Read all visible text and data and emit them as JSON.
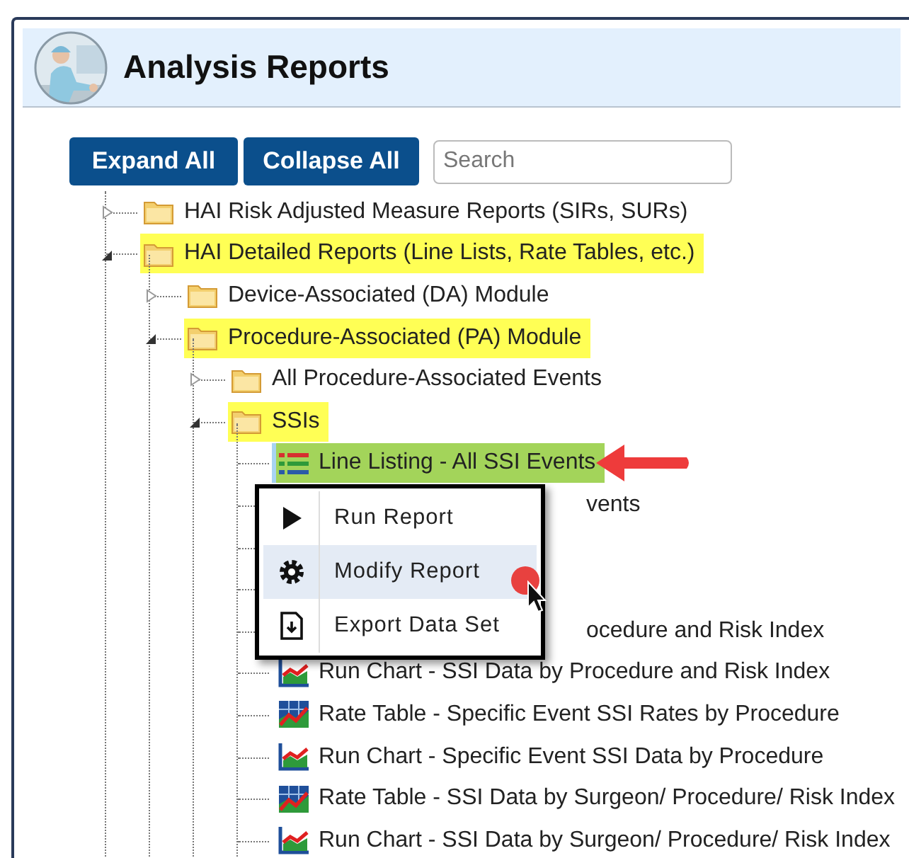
{
  "window": {
    "title": "Analysis Reports"
  },
  "toolbar": {
    "buttons": [
      "Expand All",
      "Collapse All"
    ],
    "search": {
      "placeholder": "Search"
    }
  },
  "tree": [
    {
      "kind": "folder",
      "label": "HAI Risk Adjusted Measure Reports (SIRs, SURs)",
      "expanded": false,
      "highlighted": false
    },
    {
      "kind": "folder",
      "label": "HAI Detailed Reports (Line Lists, Rate Tables, etc.)",
      "expanded": true,
      "highlighted": true,
      "children": [
        {
          "kind": "folder",
          "label": "Device-Associated (DA) Module",
          "expanded": false,
          "highlighted": false
        },
        {
          "kind": "folder",
          "label": "Procedure-Associated (PA) Module",
          "expanded": true,
          "highlighted": true,
          "children": [
            {
              "kind": "folder",
              "label": "All Procedure-Associated Events",
              "expanded": false,
              "highlighted": false
            },
            {
              "kind": "folder",
              "label": "SSIs",
              "expanded": true,
              "highlighted": true,
              "children": [
                {
                  "kind": "line-listing",
                  "label": "Line Listing - All SSI Events",
                  "selected": true
                },
                {
                  "kind": "partial",
                  "label": "vents"
                },
                {
                  "kind": "covered"
                },
                {
                  "kind": "covered"
                },
                {
                  "kind": "partial",
                  "label": "ocedure and Risk Index"
                },
                {
                  "kind": "run-chart",
                  "label": "Run Chart - SSI Data by Procedure and Risk Index",
                  "selected": false
                },
                {
                  "kind": "rate-table",
                  "label": "Rate Table - Specific Event SSI Rates by Procedure",
                  "selected": false
                },
                {
                  "kind": "run-chart",
                  "label": "Run Chart - Specific Event SSI Data by Procedure",
                  "selected": false
                },
                {
                  "kind": "rate-table",
                  "label": "Rate Table - SSI Data by Surgeon/ Procedure/ Risk Index",
                  "selected": false
                },
                {
                  "kind": "run-chart",
                  "label": "Run Chart - SSI Data by Surgeon/ Procedure/ Risk Index",
                  "selected": false
                }
              ]
            }
          ]
        }
      ]
    }
  ],
  "context_menu": {
    "items": [
      {
        "kind": "run",
        "label": "Run Report",
        "highlighted": false
      },
      {
        "kind": "modify",
        "label": "Modify Report",
        "highlighted": true
      },
      {
        "kind": "export",
        "label": "Export Data Set",
        "highlighted": false
      }
    ]
  }
}
